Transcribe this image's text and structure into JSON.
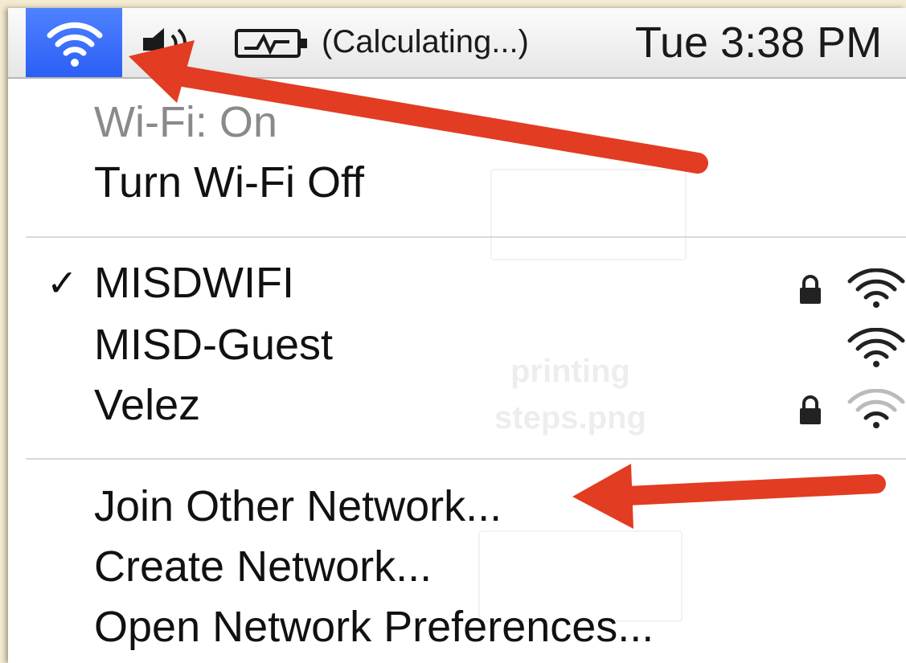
{
  "menubar": {
    "wifi_icon": "wifi-icon",
    "volume_icon": "speaker-icon",
    "battery_icon": "battery-icon",
    "battery_status": "(Calculating...)",
    "clock": "Tue 3:38 PM",
    "highlight_color": "#3a6cf7"
  },
  "wifi_menu": {
    "status": "Wi-Fi: On",
    "toggle_label": "Turn Wi-Fi Off",
    "networks": [
      {
        "name": "MISDWIFI",
        "connected": true,
        "secured": true,
        "signal_bars": 4
      },
      {
        "name": "MISD-Guest",
        "connected": false,
        "secured": false,
        "signal_bars": 4
      },
      {
        "name": "Velez",
        "connected": false,
        "secured": true,
        "signal_bars": 2
      }
    ],
    "check_glyph": "✓",
    "actions": {
      "join_other": "Join Other Network...",
      "create": "Create Network...",
      "open_prefs": "Open Network Preferences..."
    }
  },
  "desktop_background": {
    "file_label_line1": "printing",
    "file_label_line2": "steps.png"
  },
  "annotations": {
    "arrow_color": "#e23c22"
  }
}
